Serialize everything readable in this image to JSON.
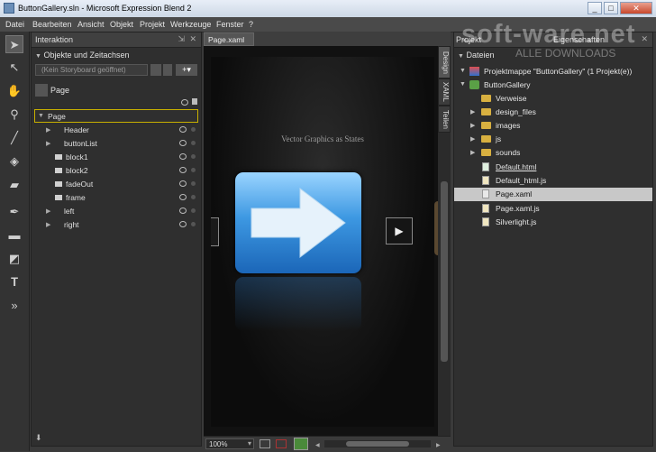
{
  "window": {
    "title": "ButtonGallery.sln - Microsoft Expression Blend 2",
    "controls": [
      "_",
      "□",
      "✕"
    ]
  },
  "menu": [
    "Datei",
    "Bearbeiten",
    "Ansicht",
    "Objekt",
    "Projekt",
    "Werkzeuge",
    "Fenster",
    "?"
  ],
  "interaction": {
    "title": "Interaktion",
    "section": "Objekte und Zeitachsen",
    "storyboard_placeholder": "(Kein Storyboard geöffnet)",
    "root": "Page",
    "tree": [
      {
        "label": "Page",
        "kind": "root"
      },
      {
        "label": "Header",
        "kind": "group"
      },
      {
        "label": "buttonList",
        "kind": "group"
      },
      {
        "label": "block1",
        "kind": "leaf"
      },
      {
        "label": "block2",
        "kind": "leaf"
      },
      {
        "label": "fadeOut",
        "kind": "leaf"
      },
      {
        "label": "frame",
        "kind": "leaf"
      },
      {
        "label": "left",
        "kind": "group"
      },
      {
        "label": "right",
        "kind": "group"
      }
    ]
  },
  "document": {
    "tab": "Page.xaml",
    "heading": "Vector Graphics as States",
    "zoom": "100%",
    "side_tabs": [
      "Design",
      "XAML",
      "Teilen"
    ]
  },
  "project": {
    "tabs": [
      "Projekt",
      "Eigenschaften"
    ],
    "files_header": "Dateien",
    "items": [
      {
        "label": "Projektmappe \"ButtonGallery\" (1 Projekt(e))",
        "kind": "solution",
        "depth": 0,
        "expanded": true
      },
      {
        "label": "ButtonGallery",
        "kind": "project",
        "depth": 1,
        "expanded": true
      },
      {
        "label": "Verweise",
        "kind": "folder",
        "depth": 2
      },
      {
        "label": "design_files",
        "kind": "folder",
        "depth": 2,
        "expander": true
      },
      {
        "label": "images",
        "kind": "folder",
        "depth": 2,
        "expander": true
      },
      {
        "label": "js",
        "kind": "folder",
        "depth": 2,
        "expander": true
      },
      {
        "label": "sounds",
        "kind": "folder",
        "depth": 2,
        "expander": true
      },
      {
        "label": "Default.html",
        "kind": "html",
        "depth": 2
      },
      {
        "label": "Default_html.js",
        "kind": "js",
        "depth": 2
      },
      {
        "label": "Page.xaml",
        "kind": "xaml",
        "depth": 2,
        "selected": true
      },
      {
        "label": "Page.xaml.js",
        "kind": "js",
        "depth": 2
      },
      {
        "label": "Silverlight.js",
        "kind": "js",
        "depth": 2
      }
    ]
  },
  "watermark": {
    "main": "soft-ware.net",
    "sub": "ALLE DOWNLOADS"
  },
  "colors": {
    "accent_blue": "#2f7fd0",
    "selection": "#c8c8c8",
    "folder": "#d8b040"
  }
}
